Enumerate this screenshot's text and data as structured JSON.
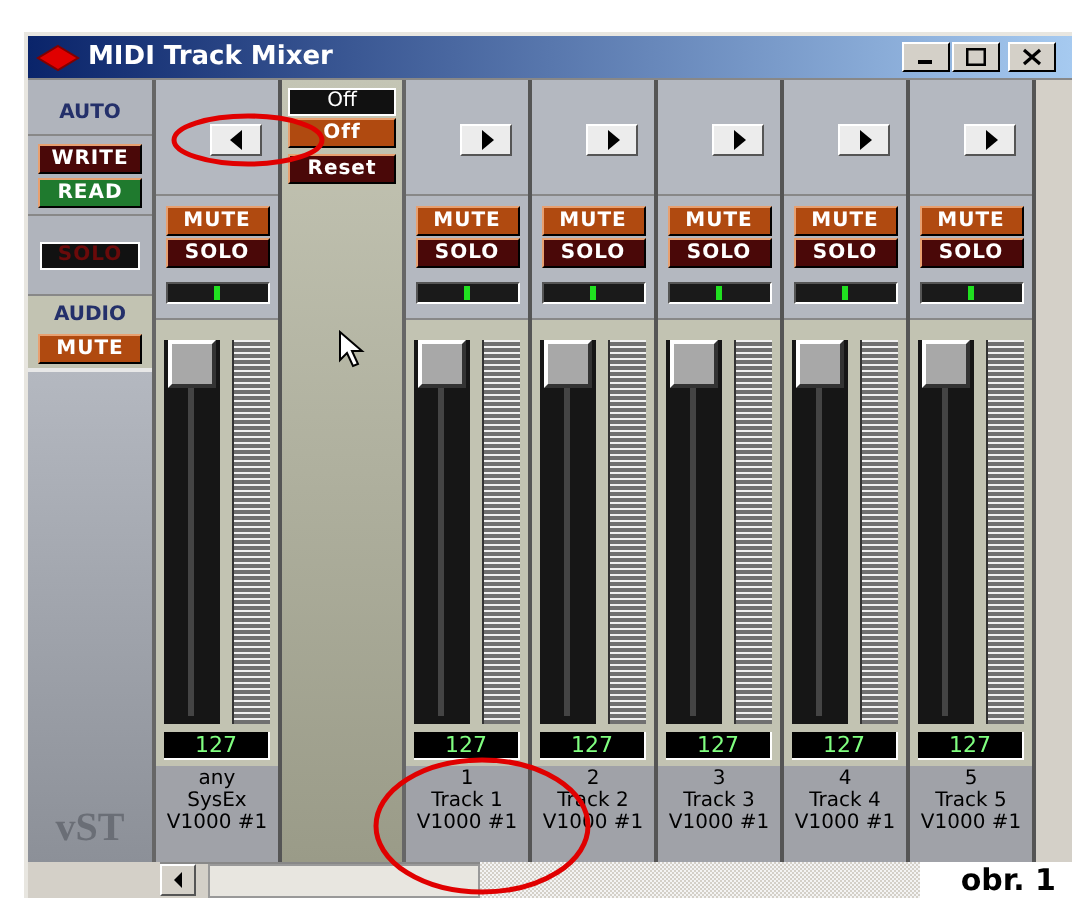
{
  "window": {
    "title": "MIDI Track Mixer"
  },
  "left_panel": {
    "auto_label": "AUTO",
    "write": {
      "label": "WRITE",
      "on": false
    },
    "read": {
      "label": "READ",
      "on": true
    },
    "solo": {
      "label": "SOLO",
      "on": false
    },
    "audio_label": "AUDIO",
    "audio_mute": "MUTE",
    "logo": "vST"
  },
  "master": {
    "display": "Off",
    "mode_button": "Off",
    "reset_button": "Reset"
  },
  "channels": [
    {
      "kind": "left",
      "mute": "MUTE",
      "solo": "SOLO",
      "pan": {
        "level": 0.5
      },
      "fader": {
        "level": 1
      },
      "value": "127",
      "label": [
        "any",
        "SysEx",
        "V1000 #1"
      ]
    },
    {
      "kind": "right",
      "mute": "MUTE",
      "solo": "SOLO",
      "pan": {
        "level": 0.5
      },
      "fader": {
        "level": 1
      },
      "value": "127",
      "label": [
        "1",
        "Track 1",
        "V1000 #1"
      ]
    },
    {
      "kind": "right",
      "mute": "MUTE",
      "solo": "SOLO",
      "pan": {
        "level": 0.5
      },
      "fader": {
        "level": 1
      },
      "value": "127",
      "label": [
        "2",
        "Track 2",
        "V1000 #1"
      ]
    },
    {
      "kind": "right",
      "mute": "MUTE",
      "solo": "SOLO",
      "pan": {
        "level": 0.5
      },
      "fader": {
        "level": 1
      },
      "value": "127",
      "label": [
        "3",
        "Track 3",
        "V1000 #1"
      ]
    },
    {
      "kind": "right",
      "mute": "MUTE",
      "solo": "SOLO",
      "pan": {
        "level": 0.5
      },
      "fader": {
        "level": 1
      },
      "value": "127",
      "label": [
        "4",
        "Track 4",
        "V1000 #1"
      ]
    },
    {
      "kind": "right",
      "mute": "MUTE",
      "solo": "SOLO",
      "pan": {
        "level": 0.5
      },
      "fader": {
        "level": 1
      },
      "value": "127",
      "label": [
        "5",
        "Track 5",
        "V1000 #1"
      ]
    }
  ],
  "caption": "obr. 1"
}
